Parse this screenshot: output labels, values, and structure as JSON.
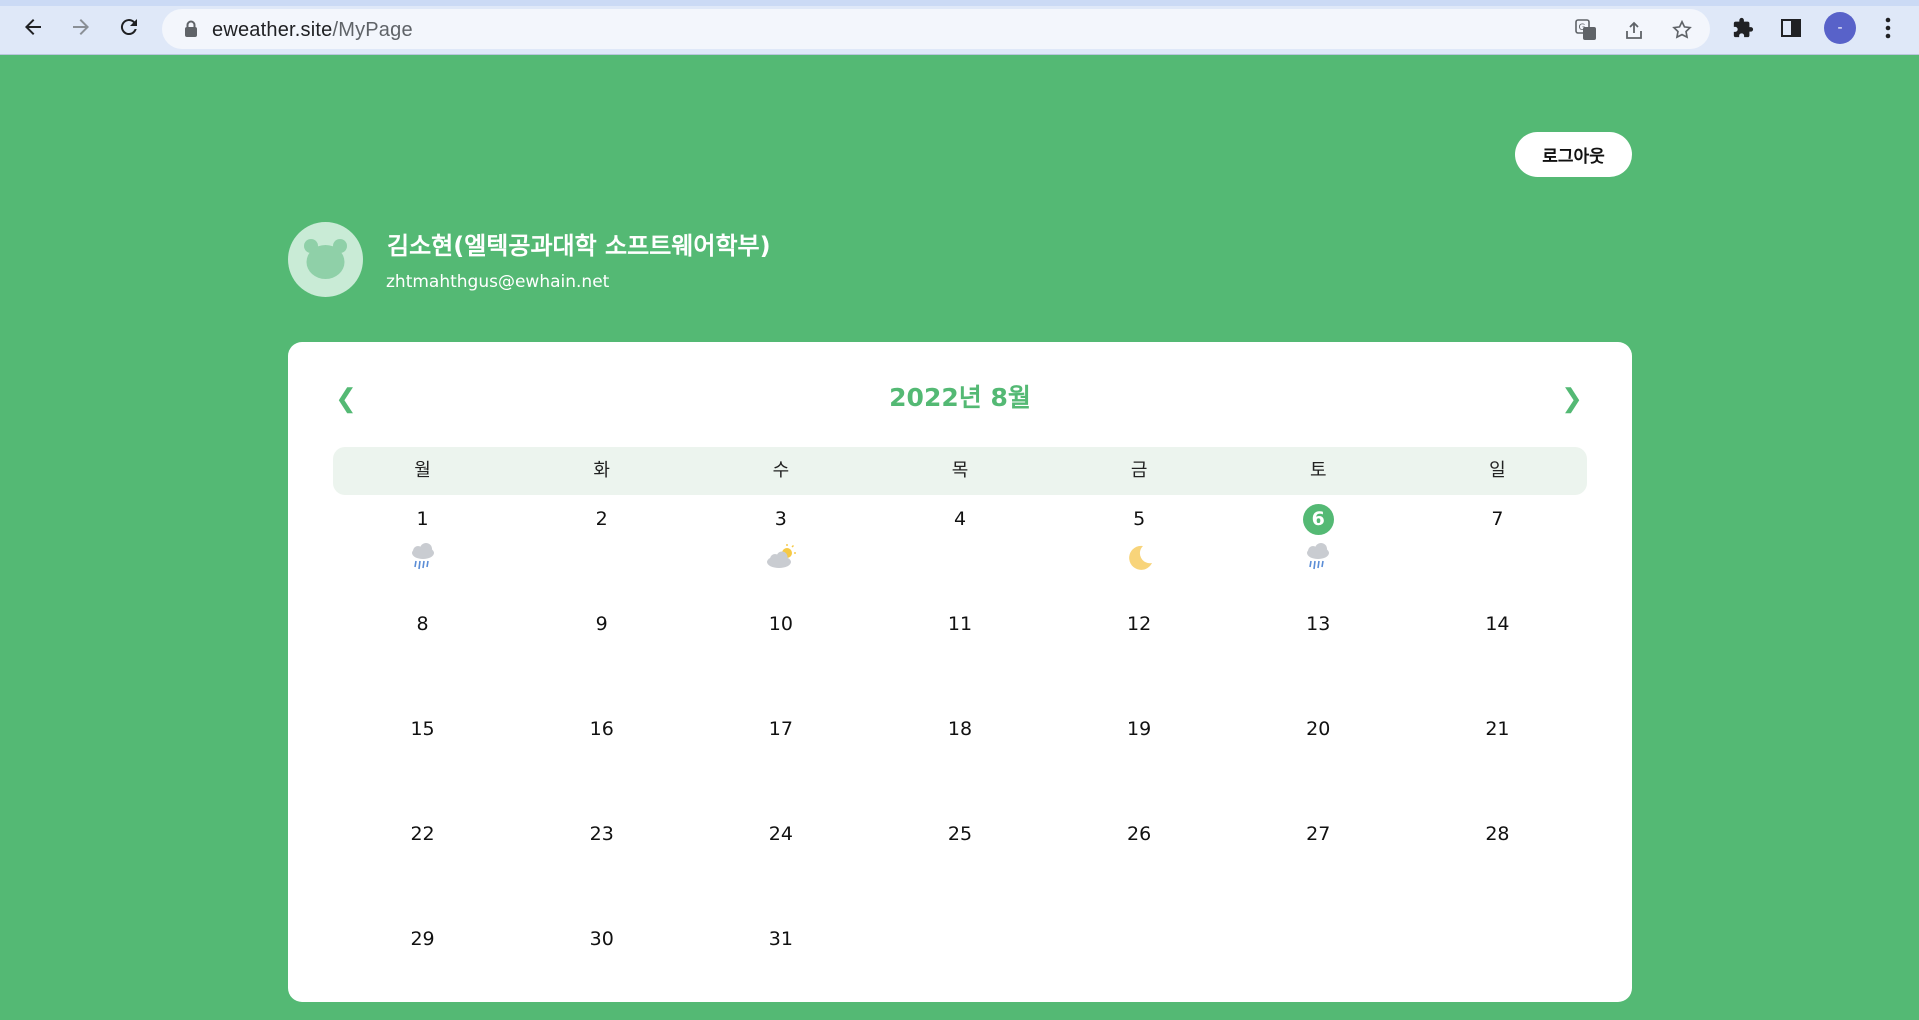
{
  "browser": {
    "url_host": "eweather.site",
    "url_path": "/MyPage",
    "profile_initial": "-"
  },
  "page": {
    "logout_label": "로그아웃",
    "profile": {
      "name": "김소현(엘텍공과대학 소프트웨어학부)",
      "email": "zhtmahthgus@ewhain.net"
    },
    "calendar": {
      "title": "2022년 8월",
      "prev_label": "❮",
      "next_label": "❯",
      "weekdays": [
        "월",
        "화",
        "수",
        "목",
        "금",
        "토",
        "일"
      ],
      "today": 6,
      "weeks": [
        [
          {
            "day": "1",
            "weather": "rain"
          },
          {
            "day": "2",
            "weather": ""
          },
          {
            "day": "3",
            "weather": "partly-sunny"
          },
          {
            "day": "4",
            "weather": ""
          },
          {
            "day": "5",
            "weather": "moon"
          },
          {
            "day": "6",
            "weather": "rain"
          },
          {
            "day": "7",
            "weather": ""
          }
        ],
        [
          {
            "day": "8",
            "weather": ""
          },
          {
            "day": "9",
            "weather": ""
          },
          {
            "day": "10",
            "weather": ""
          },
          {
            "day": "11",
            "weather": ""
          },
          {
            "day": "12",
            "weather": ""
          },
          {
            "day": "13",
            "weather": ""
          },
          {
            "day": "14",
            "weather": ""
          }
        ],
        [
          {
            "day": "15",
            "weather": ""
          },
          {
            "day": "16",
            "weather": ""
          },
          {
            "day": "17",
            "weather": ""
          },
          {
            "day": "18",
            "weather": ""
          },
          {
            "day": "19",
            "weather": ""
          },
          {
            "day": "20",
            "weather": ""
          },
          {
            "day": "21",
            "weather": ""
          }
        ],
        [
          {
            "day": "22",
            "weather": ""
          },
          {
            "day": "23",
            "weather": ""
          },
          {
            "day": "24",
            "weather": ""
          },
          {
            "day": "25",
            "weather": ""
          },
          {
            "day": "26",
            "weather": ""
          },
          {
            "day": "27",
            "weather": ""
          },
          {
            "day": "28",
            "weather": ""
          }
        ],
        [
          {
            "day": "29",
            "weather": ""
          },
          {
            "day": "30",
            "weather": ""
          },
          {
            "day": "31",
            "weather": ""
          },
          {
            "day": "",
            "weather": ""
          },
          {
            "day": "",
            "weather": ""
          },
          {
            "day": "",
            "weather": ""
          },
          {
            "day": "",
            "weather": ""
          }
        ]
      ]
    }
  },
  "colors": {
    "background": "#54b974",
    "accent": "#54b974",
    "weekday_bar": "#ecf4ee",
    "card": "#ffffff"
  },
  "icons": [
    "back-arrow-icon",
    "forward-arrow-icon",
    "reload-icon",
    "lock-icon",
    "translate-icon",
    "share-icon",
    "bookmark-star-icon",
    "extensions-icon",
    "side-panel-icon",
    "menu-kebab-icon",
    "bear-avatar-icon",
    "rain-cloud-icon",
    "partly-sunny-icon",
    "moon-icon"
  ]
}
